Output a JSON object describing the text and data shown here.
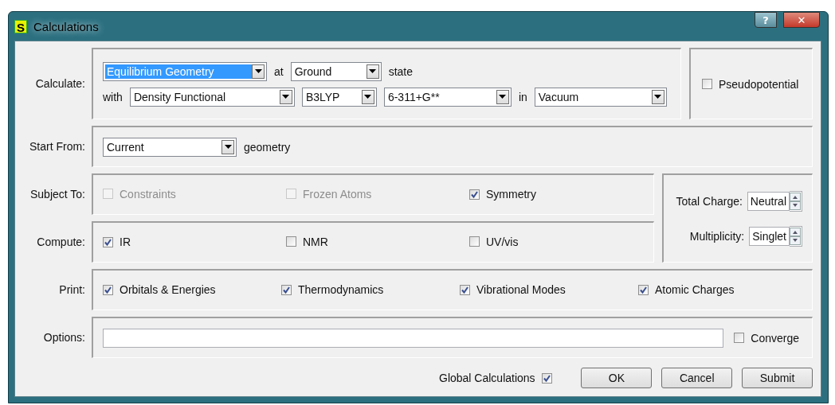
{
  "window": {
    "icon_letter": "S",
    "title": "Calculations",
    "help_button": "?",
    "close_button": "✕"
  },
  "calculate": {
    "label": "Calculate:",
    "task": {
      "value": "Equilibrium Geometry",
      "highlighted": true
    },
    "at_label": "at",
    "state": {
      "value": "Ground"
    },
    "state_label": "state",
    "with_label": "with",
    "method": {
      "value": "Density Functional"
    },
    "functional": {
      "value": "B3LYP"
    },
    "basis_set": {
      "value": "6-311+G**"
    },
    "in_label": "in",
    "solvent": {
      "value": "Vacuum"
    },
    "pseudopotential": {
      "label": "Pseudopotential",
      "checked": false
    }
  },
  "start_from": {
    "label": "Start From:",
    "value": "Current",
    "suffix": "geometry"
  },
  "subject_to": {
    "label": "Subject To:",
    "items": [
      {
        "label": "Constraints",
        "checked": false,
        "disabled": true
      },
      {
        "label": "Frozen Atoms",
        "checked": false,
        "disabled": true
      },
      {
        "label": "Symmetry",
        "checked": true,
        "disabled": false
      }
    ]
  },
  "compute": {
    "label": "Compute:",
    "items": [
      {
        "label": "IR",
        "checked": true,
        "disabled": false
      },
      {
        "label": "NMR",
        "checked": false,
        "disabled": false
      },
      {
        "label": "UV/vis",
        "checked": false,
        "disabled": false
      }
    ]
  },
  "charge": {
    "total_charge_label": "Total Charge:",
    "total_charge": "Neutral",
    "multiplicity_label": "Multiplicity:",
    "multiplicity": "Singlet"
  },
  "print": {
    "label": "Print:",
    "items": [
      {
        "label": "Orbitals & Energies",
        "checked": true,
        "disabled": false
      },
      {
        "label": "Thermodynamics",
        "checked": true,
        "disabled": false
      },
      {
        "label": "Vibrational Modes",
        "checked": true,
        "disabled": false
      },
      {
        "label": "Atomic Charges",
        "checked": true,
        "disabled": false
      }
    ]
  },
  "options": {
    "label": "Options:",
    "converge": {
      "label": "Converge",
      "checked": false
    }
  },
  "global_calculations": {
    "label": "Global Calculations",
    "checked": true
  },
  "buttons": [
    "OK",
    "Cancel",
    "Submit"
  ]
}
